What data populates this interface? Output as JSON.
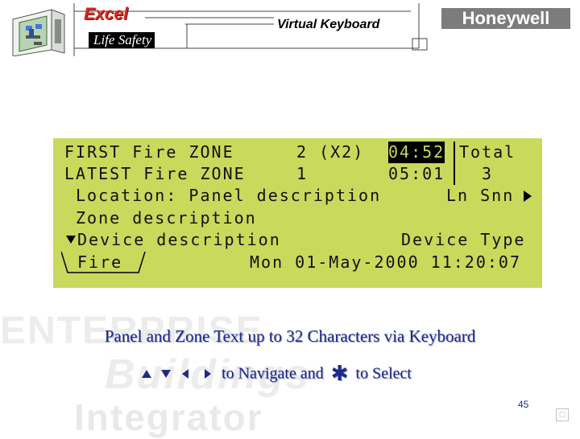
{
  "header": {
    "brand_excel": "Excel",
    "brand_life_safety": "Life Safety",
    "title": "Virtual Keyboard",
    "logo": "Honeywell"
  },
  "lcd": {
    "row1": {
      "label": "FIRST Fire ZONE",
      "zone": "2 (X2)",
      "time": "04:52",
      "right": "Total"
    },
    "row2": {
      "label": "LATEST Fire ZONE",
      "zone": "1",
      "time": "05:01",
      "right": "3"
    },
    "row3": {
      "left": "Location: Panel description",
      "right": "Ln Snn"
    },
    "row4": {
      "left": "Zone description"
    },
    "row5": {
      "left": "Device description",
      "right": "Device Type"
    },
    "row6": {
      "tab": "Fire",
      "datetime": "Mon 01-May-2000 11:20:07"
    }
  },
  "captions": {
    "line1": "Panel and Zone Text up to 32 Characters via Keyboard",
    "navigate": "to Navigate and",
    "select": "to Select",
    "star_icon": "asterisk-icon",
    "arrow_icons": [
      "up-arrow-icon",
      "down-arrow-icon",
      "left-arrow-icon",
      "right-arrow-icon"
    ]
  },
  "watermark": {
    "line1": "ENTERPRISE",
    "line2": "Buildings",
    "line3": "Integrator"
  },
  "footer": {
    "page_number": "45"
  },
  "colors": {
    "lcd_bg": "#c9d95c",
    "caption": "#1e2a8a",
    "excel_red": "#d62a1f",
    "logo_gray": "#7c7c7c"
  }
}
